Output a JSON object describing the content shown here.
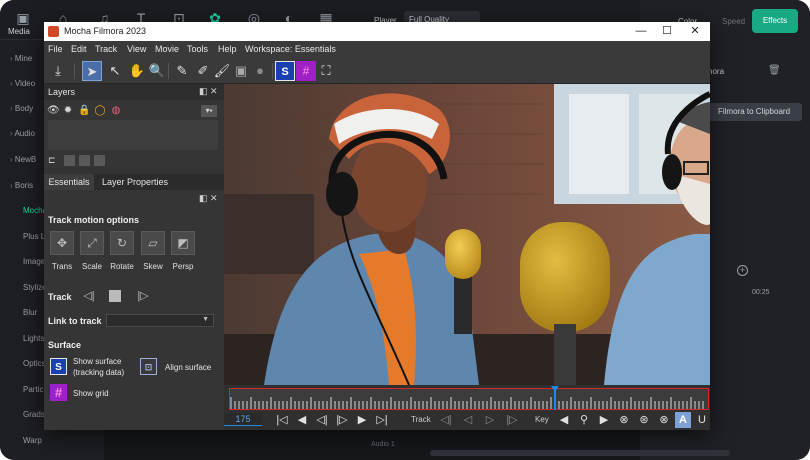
{
  "filmora": {
    "top_tabs": [
      {
        "label": "Media",
        "icon": "media-icon"
      },
      {
        "label": "",
        "icon": "stock-media-icon"
      },
      {
        "label": "",
        "icon": "music-note-icon"
      },
      {
        "label": "",
        "icon": "text-icon"
      },
      {
        "label": "",
        "icon": "transitions-icon"
      },
      {
        "label": "",
        "icon": "effects-puzzle-icon"
      },
      {
        "label": "",
        "icon": "elements-icon"
      },
      {
        "label": "",
        "icon": "stickers-icon"
      },
      {
        "label": "",
        "icon": "templates-icon"
      }
    ],
    "left_panel": [
      {
        "label": "Mine",
        "type": "caret"
      },
      {
        "label": "Video",
        "type": "caret"
      },
      {
        "label": "Body",
        "type": "caret"
      },
      {
        "label": "Audio",
        "type": "caret"
      },
      {
        "label": "NewB",
        "type": "caret"
      },
      {
        "label": "Boris",
        "type": "caret"
      },
      {
        "label": "Mocha",
        "type": "active"
      },
      {
        "label": "Plus L",
        "type": "sub"
      },
      {
        "label": "Image",
        "type": "sub"
      },
      {
        "label": "Stylize",
        "type": "sub"
      },
      {
        "label": "Blur",
        "type": "sub"
      },
      {
        "label": "Lights",
        "type": "sub"
      },
      {
        "label": "Optics",
        "type": "sub"
      },
      {
        "label": "Partic",
        "type": "sub"
      },
      {
        "label": "Grads",
        "type": "sub"
      },
      {
        "label": "Warp",
        "type": "sub"
      }
    ],
    "player_label": "Player",
    "quality": "Full Quality",
    "right_tabs": {
      "color": "Color",
      "speed": "Speed",
      "effects": "Effects"
    },
    "effect_name": "nora",
    "copy_button": "Filmora to Clipboard",
    "time_marker": "00:25",
    "audio_track": "Audio 1",
    "accent_color": "#19a983"
  },
  "mocha": {
    "title": "Mocha Filmora 2023",
    "window_controls": {
      "minimize": "—",
      "maximize": "☐",
      "close": "✕"
    },
    "menu": [
      "File",
      "Edit",
      "Track",
      "View",
      "Movie",
      "Tools",
      "Help",
      "Workspace: Essentials"
    ],
    "toolbar": [
      {
        "icon": "export-icon",
        "glyph": "⤓"
      },
      {
        "icon": "pick-cursor-icon",
        "glyph": "➤",
        "selected": true
      },
      {
        "icon": "add-point-cursor-icon",
        "glyph": "↖"
      },
      {
        "icon": "pan-hand-icon",
        "glyph": "✋"
      },
      {
        "icon": "zoom-magnifier-icon",
        "glyph": "🔍"
      },
      {
        "icon": "xspline-pen-icon",
        "glyph": "✎"
      },
      {
        "icon": "bezier-pen-icon",
        "glyph": "✐"
      },
      {
        "icon": "brush-icon",
        "glyph": "🖌"
      },
      {
        "icon": "clear-icon",
        "glyph": "▣"
      },
      {
        "icon": "settings-disc-icon",
        "glyph": "●"
      },
      {
        "icon": "surface-s-icon",
        "glyph": "S"
      },
      {
        "icon": "grid-icon",
        "glyph": "#"
      },
      {
        "icon": "fit-frame-icon",
        "glyph": "⛶"
      }
    ],
    "layers_panel": {
      "title": "Layers"
    },
    "props_tabs": [
      "Essentials",
      "Layer Properties"
    ],
    "motion": {
      "title": "Track motion options",
      "buttons": [
        {
          "label": "Trans",
          "glyph": "✥"
        },
        {
          "label": "Scale",
          "glyph": "⤢"
        },
        {
          "label": "Rotate",
          "glyph": "↻"
        },
        {
          "label": "Skew",
          "glyph": "▱"
        },
        {
          "label": "Persp",
          "glyph": "◩"
        }
      ]
    },
    "track_label": "Track",
    "link_label": "Link to track",
    "link_value": "",
    "surface": {
      "title": "Surface",
      "show_surface_line1": "Show surface",
      "show_surface_line2": "(tracking data)",
      "align_surface": "Align surface",
      "show_grid": "Show grid"
    },
    "timeline": {
      "frame": "175",
      "playhead_fraction": 0.68,
      "track_label": "Track",
      "key_label": "Key"
    }
  }
}
